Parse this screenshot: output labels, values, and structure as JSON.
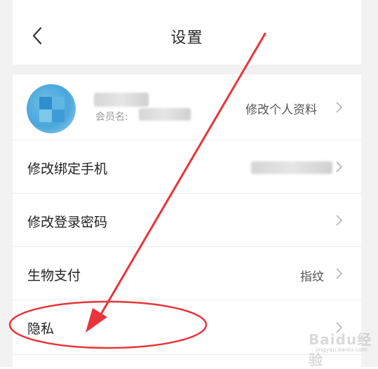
{
  "header": {
    "title": "设置"
  },
  "profile": {
    "member_label": "会员名:",
    "edit_label": "修改个人资料"
  },
  "rows": [
    {
      "label": "修改绑定手机",
      "value": ""
    },
    {
      "label": "修改登录密码",
      "value": ""
    },
    {
      "label": "生物支付",
      "value": "指纹"
    },
    {
      "label": "隐私",
      "value": ""
    }
  ],
  "watermark": {
    "brand": "Baidu经验",
    "url": "jingyan.baidu.com"
  },
  "colors": {
    "annotation": "#e8343a",
    "section_gap": "#f1f1f1"
  },
  "icons": {
    "back": "chevron-left-icon",
    "row": "chevron-right-icon"
  }
}
